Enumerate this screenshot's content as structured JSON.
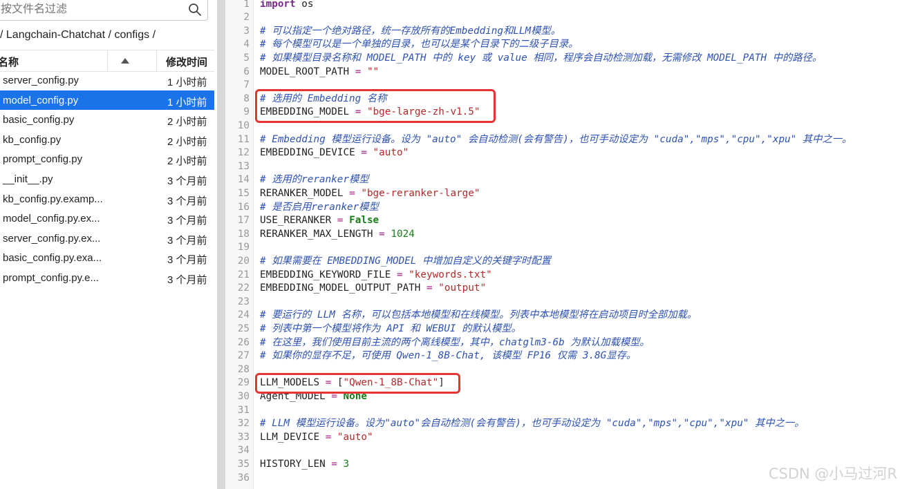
{
  "sidebar": {
    "search": {
      "placeholder": "按文件名过滤"
    },
    "breadcrumb": "/ Langchain-Chatchat / configs /",
    "columns": {
      "name": "名称",
      "modified": "修改时间"
    },
    "files": [
      {
        "name": "server_config.py",
        "time": "1 小时前",
        "selected": false
      },
      {
        "name": "model_config.py",
        "time": "1 小时前",
        "selected": true
      },
      {
        "name": "basic_config.py",
        "time": "2 小时前",
        "selected": false
      },
      {
        "name": "kb_config.py",
        "time": "2 小时前",
        "selected": false
      },
      {
        "name": "prompt_config.py",
        "time": "2 小时前",
        "selected": false
      },
      {
        "name": "__init__.py",
        "time": "3 个月前",
        "selected": false
      },
      {
        "name": "kb_config.py.examp...",
        "time": "3 个月前",
        "selected": false
      },
      {
        "name": "model_config.py.ex...",
        "time": "3 个月前",
        "selected": false
      },
      {
        "name": "server_config.py.ex...",
        "time": "3 个月前",
        "selected": false
      },
      {
        "name": "basic_config.py.exa...",
        "time": "3 个月前",
        "selected": false
      },
      {
        "name": "prompt_config.py.e...",
        "time": "3 个月前",
        "selected": false
      }
    ]
  },
  "editor": {
    "highlighted_lines": [
      [
        8,
        9
      ],
      [
        29,
        29
      ]
    ],
    "lines": [
      [
        [
          "kw",
          "import"
        ],
        [
          "",
          " os"
        ]
      ],
      [],
      [
        [
          "cm",
          "# 可以指定一个绝对路径，统一存放所有的Embedding和LLM模型。"
        ]
      ],
      [
        [
          "cm",
          "# 每个模型可以是一个单独的目录，也可以是某个目录下的二级子目录。"
        ]
      ],
      [
        [
          "cm",
          "# 如果模型目录名称和 MODEL_PATH 中的 key 或 value 相同，程序会自动检测加载，无需修改 MODEL_PATH 中的路径。"
        ]
      ],
      [
        [
          "",
          "MODEL_ROOT_PATH "
        ],
        [
          "op",
          "="
        ],
        [
          "",
          " "
        ],
        [
          "st",
          "\"\""
        ]
      ],
      [],
      [
        [
          "cm",
          "# 选用的 Embedding 名称"
        ]
      ],
      [
        [
          "",
          "EMBEDDING_MODEL "
        ],
        [
          "op",
          "="
        ],
        [
          "",
          " "
        ],
        [
          "st",
          "\"bge-large-zh-v1.5\""
        ]
      ],
      [],
      [
        [
          "cm",
          "# Embedding 模型运行设备。设为 \"auto\" 会自动检测(会有警告)，也可手动设定为 \"cuda\",\"mps\",\"cpu\",\"xpu\" 其中之一。"
        ]
      ],
      [
        [
          "",
          "EMBEDDING_DEVICE "
        ],
        [
          "op",
          "="
        ],
        [
          "",
          " "
        ],
        [
          "st",
          "\"auto\""
        ]
      ],
      [],
      [
        [
          "cm",
          "# 选用的reranker模型"
        ]
      ],
      [
        [
          "",
          "RERANKER_MODEL "
        ],
        [
          "op",
          "="
        ],
        [
          "",
          " "
        ],
        [
          "st",
          "\"bge-reranker-large\""
        ]
      ],
      [
        [
          "cm",
          "# 是否启用reranker模型"
        ]
      ],
      [
        [
          "",
          "USE_RERANKER "
        ],
        [
          "op",
          "="
        ],
        [
          "",
          " "
        ],
        [
          "bl",
          "False"
        ]
      ],
      [
        [
          "",
          "RERANKER_MAX_LENGTH "
        ],
        [
          "op",
          "="
        ],
        [
          "",
          " "
        ],
        [
          "nm",
          "1024"
        ]
      ],
      [],
      [
        [
          "cm",
          "# 如果需要在 EMBEDDING_MODEL 中增加自定义的关键字时配置"
        ]
      ],
      [
        [
          "",
          "EMBEDDING_KEYWORD_FILE "
        ],
        [
          "op",
          "="
        ],
        [
          "",
          " "
        ],
        [
          "st",
          "\"keywords.txt\""
        ]
      ],
      [
        [
          "",
          "EMBEDDING_MODEL_OUTPUT_PATH "
        ],
        [
          "op",
          "="
        ],
        [
          "",
          " "
        ],
        [
          "st",
          "\"output\""
        ]
      ],
      [],
      [
        [
          "cm",
          "# 要运行的 LLM 名称，可以包括本地模型和在线模型。列表中本地模型将在启动项目时全部加载。"
        ]
      ],
      [
        [
          "cm",
          "# 列表中第一个模型将作为 API 和 WEBUI 的默认模型。"
        ]
      ],
      [
        [
          "cm",
          "# 在这里，我们使用目前主流的两个离线模型，其中，chatglm3-6b 为默认加载模型。"
        ]
      ],
      [
        [
          "cm",
          "# 如果你的显存不足，可使用 Qwen-1_8B-Chat, 该模型 FP16 仅需 3.8G显存。"
        ]
      ],
      [],
      [
        [
          "",
          "LLM_MODELS "
        ],
        [
          "op",
          "="
        ],
        [
          "",
          " ["
        ],
        [
          "st",
          "\"Qwen-1_8B-Chat\""
        ],
        [
          "",
          "]"
        ]
      ],
      [
        [
          "",
          "Agent_MODEL "
        ],
        [
          "op",
          "="
        ],
        [
          "",
          " "
        ],
        [
          "bl",
          "None"
        ]
      ],
      [],
      [
        [
          "cm",
          "# LLM 模型运行设备。设为\"auto\"会自动检测(会有警告)，也可手动设定为 \"cuda\",\"mps\",\"cpu\",\"xpu\" 其中之一。"
        ]
      ],
      [
        [
          "",
          "LLM_DEVICE "
        ],
        [
          "op",
          "="
        ],
        [
          "",
          " "
        ],
        [
          "st",
          "\"auto\""
        ]
      ],
      [],
      [
        [
          "",
          "HISTORY_LEN "
        ],
        [
          "op",
          "="
        ],
        [
          "",
          " "
        ],
        [
          "nm",
          "3"
        ]
      ],
      []
    ]
  },
  "watermark": "CSDN @小马过河R",
  "colors": {
    "selection": "#1a73e8",
    "highlight_box": "#e43532",
    "comment": "#2e52b3",
    "string": "#b22a2a",
    "keyword": "#7a2a8a",
    "number": "#177e17"
  }
}
